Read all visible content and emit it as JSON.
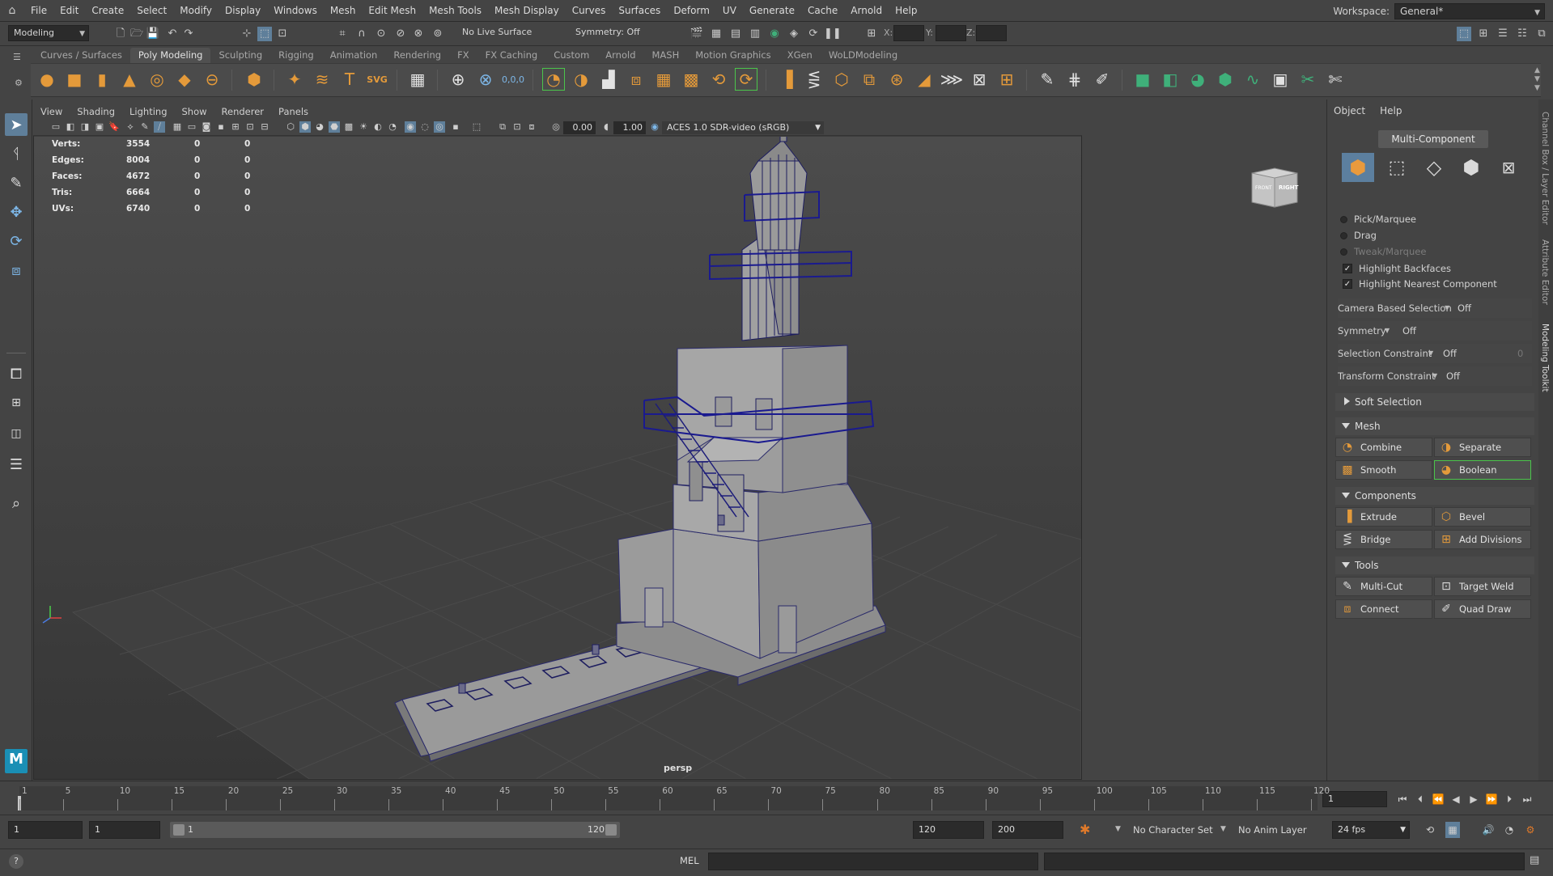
{
  "menubar": {
    "items": [
      "File",
      "Edit",
      "Create",
      "Select",
      "Modify",
      "Display",
      "Windows",
      "Mesh",
      "Edit Mesh",
      "Mesh Tools",
      "Mesh Display",
      "Curves",
      "Surfaces",
      "Deform",
      "UV",
      "Generate",
      "Cache",
      "Arnold",
      "Help"
    ],
    "workspace_label": "Workspace:",
    "workspace_value": "General*"
  },
  "statusline": {
    "menu_set": "Modeling",
    "live_surface": "No Live Surface",
    "symmetry": "Symmetry: Off",
    "coord_labels": [
      "X:",
      "Y:",
      "Z:"
    ]
  },
  "shelf": {
    "tabs": [
      "Curves / Surfaces",
      "Poly Modeling",
      "Sculpting",
      "Rigging",
      "Animation",
      "Rendering",
      "FX",
      "FX Caching",
      "Custom",
      "Arnold",
      "MASH",
      "Motion Graphics",
      "XGen",
      "WoLDModeling"
    ],
    "active_tab": "Poly Modeling"
  },
  "viewport": {
    "menu": [
      "View",
      "Shading",
      "Lighting",
      "Show",
      "Renderer",
      "Panels"
    ],
    "exposure": "0.00",
    "gamma": "1.00",
    "colorspace": "ACES 1.0 SDR-video (sRGB)",
    "camera": "persp",
    "hud": [
      {
        "label": "Verts:",
        "v1": "3554",
        "v2": "0",
        "v3": "0"
      },
      {
        "label": "Edges:",
        "v1": "8004",
        "v2": "0",
        "v3": "0"
      },
      {
        "label": "Faces:",
        "v1": "4672",
        "v2": "0",
        "v3": "0"
      },
      {
        "label": "Tris:",
        "v1": "6664",
        "v2": "0",
        "v3": "0"
      },
      {
        "label": "UVs:",
        "v1": "6740",
        "v2": "0",
        "v3": "0"
      }
    ],
    "viewcube": {
      "front": "FRONT",
      "right": "RIGHT"
    }
  },
  "modeling_toolkit": {
    "menu": [
      "Object",
      "Help"
    ],
    "mode": "Multi-Component",
    "pick_marquee": "Pick/Marquee",
    "drag": "Drag",
    "tweak_marquee": "Tweak/Marquee",
    "highlight_backfaces": "Highlight Backfaces",
    "highlight_nearest": "Highlight Nearest Component",
    "camera_based_selection": {
      "label": "Camera Based Selection",
      "value": "Off"
    },
    "symmetry": {
      "label": "Symmetry",
      "value": "Off"
    },
    "selection_constraint": {
      "label": "Selection Constraint",
      "value": "Off",
      "extra": "0"
    },
    "transform_constraint": {
      "label": "Transform Constraint",
      "value": "Off"
    },
    "soft_selection": "Soft Selection",
    "mesh_section": "Mesh",
    "mesh_buttons": [
      "Combine",
      "Separate",
      "Smooth",
      "Boolean"
    ],
    "components_section": "Components",
    "component_buttons": [
      "Extrude",
      "Bevel",
      "Bridge",
      "Add Divisions"
    ],
    "tools_section": "Tools",
    "tool_buttons": [
      "Multi-Cut",
      "Target Weld",
      "Connect",
      "Quad Draw"
    ]
  },
  "side_tabs": [
    "Channel Box / Layer Editor",
    "Attribute Editor",
    "Modeling Toolkit"
  ],
  "timeline": {
    "ticks": [
      "1",
      "5",
      "10",
      "15",
      "20",
      "25",
      "30",
      "35",
      "40",
      "45",
      "50",
      "55",
      "60",
      "65",
      "70",
      "75",
      "80",
      "85",
      "90",
      "95",
      "100",
      "105",
      "110",
      "115",
      "120"
    ],
    "current_frame": "1"
  },
  "range": {
    "start": "1",
    "playback_start": "1",
    "slider_start": "1",
    "slider_end": "120",
    "playback_end": "120",
    "end": "200",
    "character_set": "No Character Set",
    "anim_layer": "No Anim Layer",
    "fps": "24 fps"
  },
  "cmdline": {
    "language": "MEL"
  }
}
